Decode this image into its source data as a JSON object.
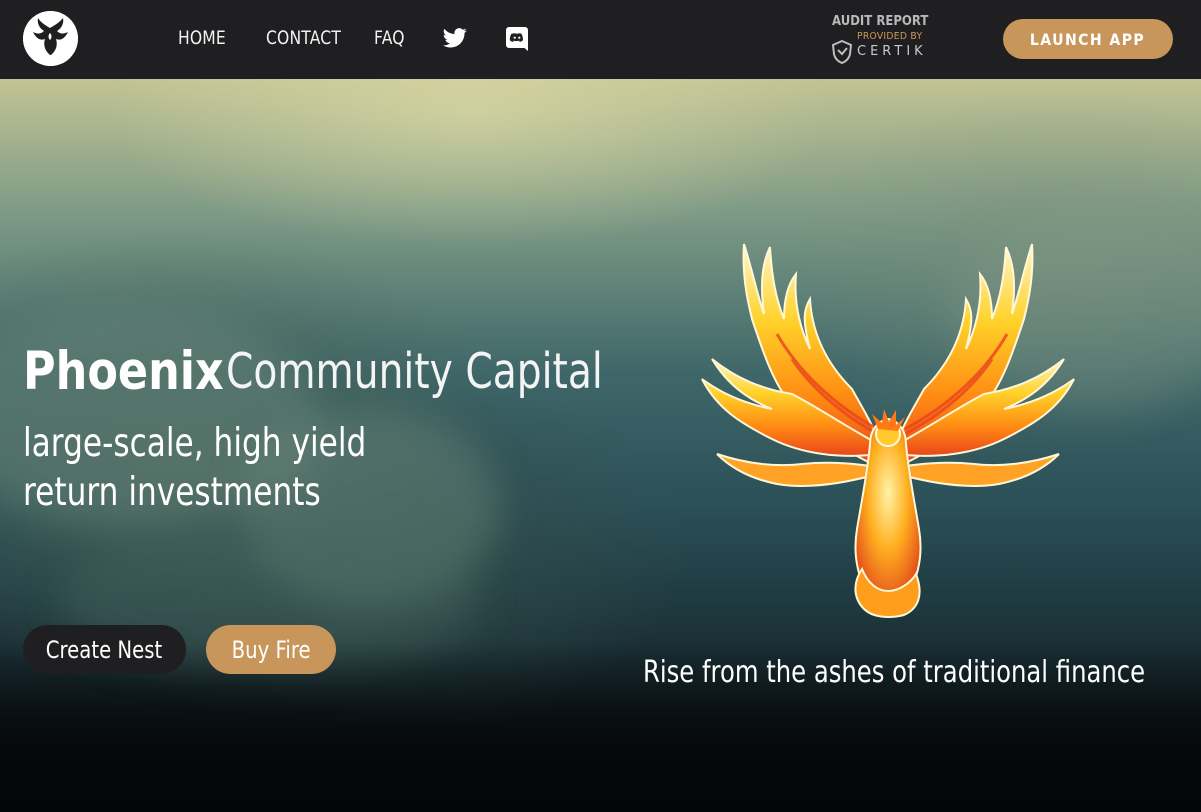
{
  "nav": {
    "links": [
      {
        "label": "HOME"
      },
      {
        "label": "CONTACT"
      },
      {
        "label": "FAQ"
      }
    ],
    "social_icons": [
      "twitter-icon",
      "discord-icon"
    ],
    "logo_icon": "phoenix-logo-icon"
  },
  "audit": {
    "title": "AUDIT REPORT",
    "subtitle": "PROVIDED BY",
    "brand": "CERTIK"
  },
  "launch_button": {
    "label": "LAUNCH APP"
  },
  "hero": {
    "title_bold": "Phoenix",
    "title_light": "Community Capital",
    "subtitle_line1": "large-scale, high yield",
    "subtitle_line2": "return investments",
    "primary_button": "Create Nest",
    "secondary_button": "Buy Fire",
    "tagline": "Rise from the ashes of traditional finance",
    "image_icon": "phoenix-bird-icon"
  },
  "colors": {
    "nav_background": "#1f1f22",
    "accent": "#c8955a",
    "dark_button": "#1f1f22",
    "text": "#ffffff"
  }
}
